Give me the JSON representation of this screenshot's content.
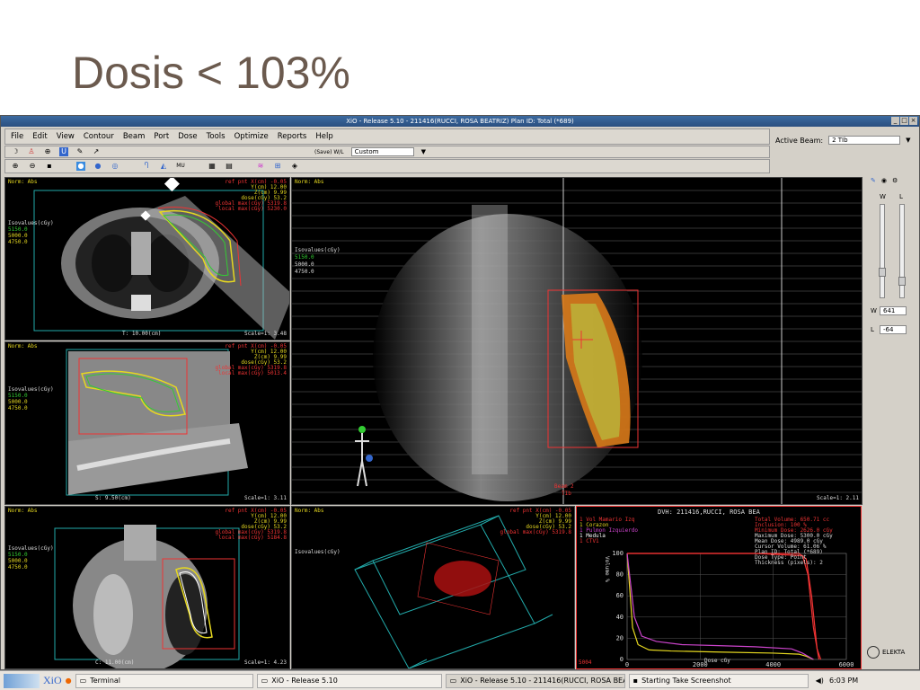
{
  "slide": {
    "title": "Dosis < 103%"
  },
  "window": {
    "title": "XiO - Release 5.10 - 211416(RUCCI, ROSA BEATRIZ) Plan ID: Total (*689)"
  },
  "menu": [
    "File",
    "Edit",
    "View",
    "Contour",
    "Beam",
    "Port",
    "Dose",
    "Tools",
    "Optimize",
    "Reports",
    "Help"
  ],
  "toolbar": {
    "save_wl_label": "(Save) W/L",
    "preset_value": "Custom"
  },
  "active_beam": {
    "label": "Active Beam:",
    "value": "2 TIb"
  },
  "panels": {
    "norm": "Norm: Abs",
    "iso_title": "Isovalues(cGy)",
    "iso": [
      "5150.0",
      "5000.0",
      "4750.0"
    ],
    "ref": [
      "ref pnt X(cm)  -0.05",
      "Y(cm)  12.00",
      "Z(cm)   9.99",
      "dose(cGy)  53.2",
      "global max(cGy) 5319.8"
    ],
    "p1": {
      "slice": "T:  10.00(cm)",
      "scale": "Scale=1: 3.48",
      "local": "local max(cGy) 5230.0"
    },
    "p2": {
      "slice": "S:   9.50(cm)",
      "scale": "Scale=1: 3.11",
      "local": "local max(cGy) 5013.4"
    },
    "p3": {
      "slice": "C:  11.00(cm)",
      "scale": "Scale=1: 4.23",
      "local": "local max(cGy) 5184.8"
    },
    "bev": {
      "scale": "Scale=1: 2.11",
      "beam": "Beam 2",
      "beam2": "TIb"
    },
    "view3d": {
      "iso_title": "Isovalues(cGy)"
    }
  },
  "dvh": {
    "title": "DVH: 211416,RUCCI, ROSA BEA",
    "legend": [
      "1 Vol Mamario Izq",
      "1 Corazon",
      "1 Pulmon Izquierdo",
      "1 Medula",
      "1 CTV1"
    ],
    "legend_colors": [
      "#e33",
      "#e6d820",
      "#c4c",
      "#fff",
      "#e33"
    ],
    "stats_labels": [
      "Total Volume:",
      "Inclusion:",
      "Minimum Dose:",
      "Maximum Dose:",
      "Mean Dose:",
      "Cursor Volume:",
      "Plan ID:",
      "Dose Type:",
      "Thickness (pixels):"
    ],
    "stats_values": [
      "650.71 cc",
      "100 %",
      "2626.0 cGy",
      "5300.0 cGy",
      "4989.0 cGy",
      "61.06 %",
      "Total (*689)",
      "Point",
      "2"
    ],
    "ylabel": "Volume %",
    "xlabel": "Dose cGy",
    "yticks": [
      "100",
      "80",
      "60",
      "40",
      "20",
      "0"
    ],
    "xticks": [
      "0",
      "2000",
      "4000",
      "6000"
    ],
    "corner": "5004"
  },
  "chart_data": {
    "type": "line",
    "title": "DVH: 211416,RUCCI, ROSA BEA",
    "xlabel": "Dose cGy",
    "ylabel": "Volume %",
    "xlim": [
      0,
      6000
    ],
    "ylim": [
      0,
      100
    ],
    "series": [
      {
        "name": "1 Vol Mamario Izq",
        "color": "#e33",
        "x": [
          0,
          2500,
          4700,
          4900,
          5050,
          5200,
          5300
        ],
        "y": [
          100,
          100,
          100,
          95,
          60,
          10,
          0
        ]
      },
      {
        "name": "1 Corazon",
        "color": "#e6d820",
        "x": [
          0,
          150,
          300,
          600,
          1200,
          2500,
          4000,
          4700,
          4900,
          5100
        ],
        "y": [
          100,
          30,
          14,
          9,
          8,
          7,
          6,
          5,
          3,
          0
        ]
      },
      {
        "name": "1 Pulmon Izquierdo",
        "color": "#c4c",
        "x": [
          0,
          200,
          400,
          800,
          1500,
          2500,
          3500,
          4500,
          4800,
          5100
        ],
        "y": [
          100,
          40,
          22,
          17,
          14,
          13,
          12,
          10,
          6,
          0
        ]
      },
      {
        "name": "1 CTV1",
        "color": "#e33",
        "x": [
          0,
          3500,
          4800,
          4950,
          5100,
          5250
        ],
        "y": [
          100,
          100,
          98,
          80,
          30,
          0
        ]
      }
    ]
  },
  "rightctl": {
    "w_label": "W",
    "l_label": "L",
    "w_value": "641",
    "l_value": "-64",
    "brand": "ELEKTA"
  },
  "taskbar": {
    "apps": [
      "XiO"
    ],
    "items": [
      "Terminal",
      "XiO - Release 5.10",
      "XiO - Release 5.10 - 211416(RUCCI, ROSA BEATRIZ) ...",
      "Starting Take Screenshot"
    ],
    "clock": "6:03 PM"
  }
}
